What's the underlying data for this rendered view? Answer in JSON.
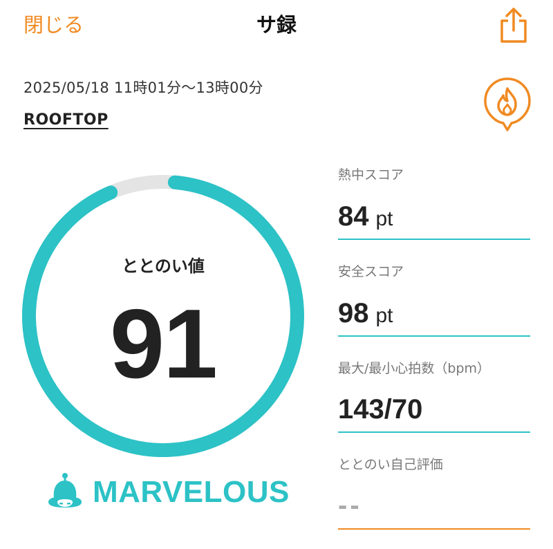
{
  "header": {
    "close_label": "閉じる",
    "title": "サ録",
    "share_icon": "share-icon"
  },
  "session": {
    "datetime": "2025/05/18 11時01分〜13時00分",
    "place": "ROOFTOP",
    "badge_icon": "fire-pin-icon"
  },
  "totonoi": {
    "label": "ととのい値",
    "value": "91",
    "progress_fraction": 0.95
  },
  "rank": {
    "icon": "sauna-hat-icon",
    "label": "MARVELOUS"
  },
  "metrics": {
    "heat": {
      "label": "熱中スコア",
      "value": "84",
      "unit": "pt"
    },
    "safety": {
      "label": "安全スコア",
      "value": "98",
      "unit": "pt"
    },
    "heart_rate": {
      "label": "最大/最小心拍数（bpm）",
      "value": "143/70"
    },
    "self_eval": {
      "label": "ととのい自己評価",
      "value": "--"
    }
  },
  "colors": {
    "accent": "#f08a22",
    "teal": "#2cc2c6",
    "track": "#e4e4e4",
    "text": "#222222"
  }
}
